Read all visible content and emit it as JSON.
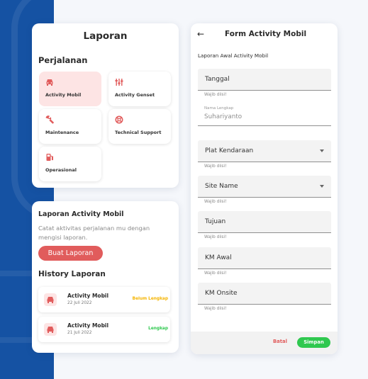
{
  "laporan": {
    "title": "Laporan",
    "section": "Perjalanan",
    "tiles": [
      {
        "label": "Activity Mobil",
        "icon": "car-icon"
      },
      {
        "label": "Activity Genset",
        "icon": "sliders-icon"
      },
      {
        "label": "Maintenance",
        "icon": "wrench-icon"
      },
      {
        "label": "Technical Support",
        "icon": "lifebuoy-icon"
      },
      {
        "label": "Operasional",
        "icon": "fuel-icon"
      }
    ]
  },
  "activity": {
    "title": "Laporan Activity Mobil",
    "description": "Catat aktivitas perjalanan mu dengan mengisi laporan.",
    "button": "Buat Laporan",
    "history_title": "History Laporan",
    "history": [
      {
        "name": "Activity Mobil",
        "date": "22 Juli 2022",
        "status": "Belum Lengkap",
        "status_color": "#f5b400"
      },
      {
        "name": "Activity Mobil",
        "date": "21 Juli 2022",
        "status": "Lengkap",
        "status_color": "#2fc84f"
      }
    ]
  },
  "form": {
    "title": "Form Activity Mobil",
    "subtitle": "Laporan Awal Activity Mobil",
    "tanggal": {
      "label": "Tanggal",
      "helper": "Wajib diisi!"
    },
    "nama": {
      "small_label": "Nama Lengkap",
      "value": "Suhariyanto"
    },
    "plat": {
      "label": "Plat Kendaraan",
      "helper": "Wajib diisi!"
    },
    "site": {
      "label": "Site Name",
      "helper": "Wajib diisi!"
    },
    "tujuan": {
      "label": "Tujuan",
      "helper": "Wajib diisi!"
    },
    "km_awal": {
      "label": "KM Awal",
      "helper": "Wajib diisi!"
    },
    "km_onsite": {
      "label": "KM Onsite",
      "helper": "Wajib diisi!"
    },
    "cancel_label": "Batal",
    "save_label": "Simpan"
  },
  "colors": {
    "accent": "#e15c5c",
    "brand_blue": "#1552a3",
    "success": "#2fc84f",
    "warning": "#f5b400"
  }
}
